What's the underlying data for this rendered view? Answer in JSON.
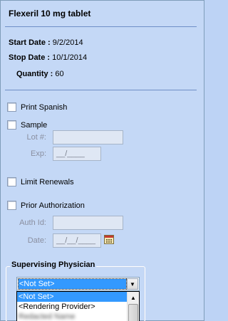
{
  "header": {
    "title": "Flexeril 10 mg tablet"
  },
  "details": {
    "start_label": "Start Date :",
    "start_value": "9/2/2014",
    "stop_label": "Stop Date :",
    "stop_value": "10/1/2014",
    "quantity_label": "Quantity :",
    "quantity_value": "60"
  },
  "options": {
    "print_spanish": "Print Spanish",
    "sample": "Sample",
    "lot_label": "Lot #:",
    "exp_label": "Exp:",
    "exp_value": "__/____",
    "limit_renewals": "Limit Renewals",
    "prior_authorization": "Prior Authorization",
    "auth_label": "Auth Id:",
    "date_label": "Date:",
    "date_value": "__/__/____"
  },
  "supervising": {
    "group_label": "Supervising Physician",
    "selected": "<Not Set>",
    "items": [
      "<Not Set>",
      "<Rendering Provider>",
      "Redacted Name"
    ]
  },
  "colors": {
    "panel_bg": "#c4d8f6",
    "separator": "#6f8fc6",
    "selection": "#3399ff"
  },
  "icons": {
    "calendar": "calendar-icon",
    "dropdown": "chevron-down-icon"
  }
}
